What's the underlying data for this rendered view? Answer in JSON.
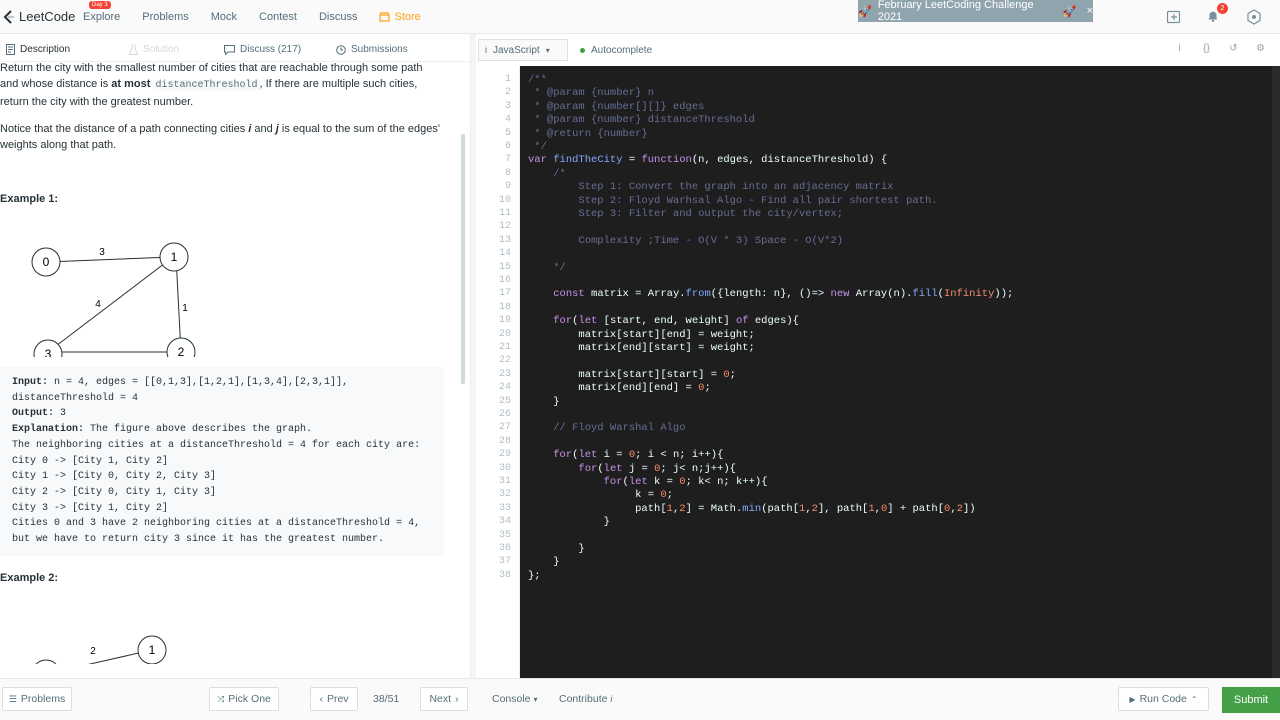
{
  "header": {
    "logo_text": "LeetCode",
    "nav": [
      {
        "label": "Explore",
        "badge": "Day 3"
      },
      {
        "label": "Problems"
      },
      {
        "label": "Mock"
      },
      {
        "label": "Contest"
      },
      {
        "label": "Discuss"
      },
      {
        "label": "Store"
      }
    ],
    "challenge_banner": "February LeetCoding Challenge 2021",
    "notification_count": "2"
  },
  "left_tabs": [
    {
      "label": "Description",
      "icon": "document-icon"
    },
    {
      "label": "Solution",
      "icon": "flask-icon"
    },
    {
      "label": "Discuss (217)",
      "icon": "discuss-icon"
    },
    {
      "label": "Submissions",
      "icon": "clock-icon"
    }
  ],
  "description": {
    "para1_a": "Return the city with the smallest number of cities that are reachable through some path and whose distance is ",
    "para1_bold": "at most",
    "para1_code": "distanceThreshold",
    "para1_b": ", If there are multiple such cities, return the city with the greatest number.",
    "para2_a": "Notice that the distance of a path connecting cities ",
    "para2_i": "i",
    "para2_and": " and ",
    "para2_j": "j",
    "para2_b": " is equal to the sum of the edges' weights along that path.",
    "example1_title": "Example 1:",
    "example2_title": "Example 2:",
    "graph1": {
      "nodes": [
        "0",
        "1",
        "2",
        "3"
      ],
      "edge_labels": [
        "3",
        "1",
        "4",
        "1"
      ]
    },
    "graph2": {
      "nodes": [
        "1"
      ],
      "edge_labels": [
        "2"
      ]
    },
    "example1": {
      "input_label": "Input:",
      "input_value": " n = 4, edges = [[0,1,3],[1,2,1],[1,3,4],[2,3,1]], distanceThreshold = 4",
      "output_label": "Output:",
      "output_value": " 3",
      "explanation_label": "Explanation:",
      "explanation_value": " The figure above describes the graph.",
      "lines": [
        "The neighboring cities at a distanceThreshold = 4 for each city are:",
        "City 0 -> [City 1, City 2]",
        "City 1 -> [City 0, City 2, City 3]",
        "City 2 -> [City 0, City 1, City 3]",
        "City 3 -> [City 1, City 2]",
        "Cities 0 and 3 have 2 neighboring cities at a distanceThreshold = 4,",
        "but we have to return city 3 since it has the greatest number."
      ]
    }
  },
  "editor": {
    "language": "JavaScript",
    "autocomplete": "Autocomplete",
    "line_numbers": [
      "1",
      "2",
      "3",
      "4",
      "5",
      "6",
      "7",
      "8",
      "9",
      "10",
      "11",
      "12",
      "13",
      "14",
      "15",
      "16",
      "17",
      "18",
      "19",
      "20",
      "21",
      "22",
      "23",
      "24",
      "25",
      "26",
      "27",
      "28",
      "29",
      "30",
      "31",
      "32",
      "33",
      "34",
      "35",
      "36",
      "37",
      "38"
    ],
    "code_lines": [
      "/**",
      " * @param {number} n",
      " * @param {number[][]} edges",
      " * @param {number} distanceThreshold",
      " * @return {number}",
      " */",
      "var findTheCity = function(n, edges, distanceThreshold) {",
      "    /*",
      "        Step 1: Convert the graph into an adjacency matrix",
      "        Step 2: Floyd Warhsal Algo - Find all pair shortest path.",
      "        Step 3: Filter and output the city/vertex;",
      "",
      "        Complexity ;Time - O(V * 3) Space - O(V*2)",
      "",
      "    */",
      "",
      "    const matrix = Array.from({length: n}, ()=> new Array(n).fill(Infinity));",
      "",
      "    for(let [start, end, weight] of edges){",
      "        matrix[start][end] = weight;",
      "        matrix[end][start] = weight;",
      "",
      "        matrix[start][start] = 0;",
      "        matrix[end][end] = 0;",
      "    }",
      "",
      "    // Floyd Warshal Algo",
      "",
      "    for(let i = 0; i < n; i++){",
      "        for(let j = 0; j< n;j++){",
      "            for(let k = 0; k< n; k++){",
      "                 k = 0;",
      "                 path[1,2] = Math.min(path[1,2], path[1,0] + path[0,2])",
      "            }",
      "",
      "        }",
      "    }",
      "};"
    ]
  },
  "footer": {
    "problems": "Problems",
    "pick_one": "Pick One",
    "prev": "Prev",
    "page": "38/51",
    "next": "Next",
    "console": "Console",
    "contribute": "Contribute",
    "run_code": "Run Code",
    "submit": "Submit"
  }
}
